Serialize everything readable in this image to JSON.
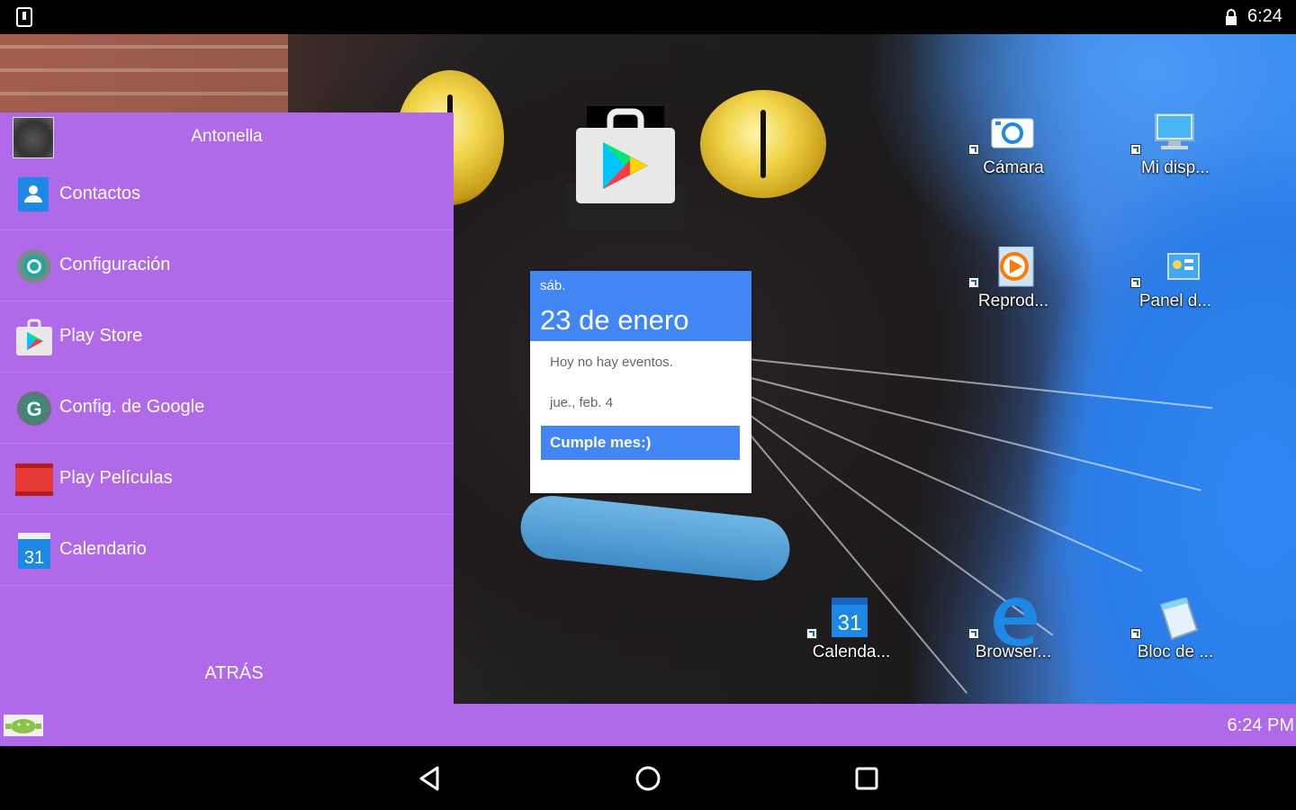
{
  "status_bar": {
    "time": "6:24",
    "notification_icon": "sdcard-icon",
    "lock_icon": "lock-icon"
  },
  "drawer": {
    "user_name": "Antonella",
    "items": [
      {
        "label": "Contactos",
        "icon": "contacts-icon"
      },
      {
        "label": "Configuración",
        "icon": "settings-icon"
      },
      {
        "label": "Play Store",
        "icon": "play-store-icon"
      },
      {
        "label": "Config. de Google",
        "icon": "google-settings-icon"
      },
      {
        "label": "Play Películas",
        "icon": "play-movies-icon"
      },
      {
        "label": "Calendario",
        "icon": "calendar-icon"
      }
    ],
    "back_label": "ATRÁS"
  },
  "widget": {
    "day": "sáb.",
    "date": "23 de enero",
    "no_events": "Hoy no hay eventos.",
    "next_date": "jue., feb. 4",
    "event_title": "Cumple mes:)"
  },
  "desktop": {
    "shortcuts": [
      {
        "label": "Cámara",
        "icon": "camera-icon"
      },
      {
        "label": "Mi disp...",
        "icon": "computer-icon"
      },
      {
        "label": "Reprod...",
        "icon": "media-player-icon"
      },
      {
        "label": "Panel d...",
        "icon": "control-panel-icon"
      },
      {
        "label": "Calenda...",
        "icon": "calendar-icon",
        "badge": "31"
      },
      {
        "label": "Browser...",
        "icon": "edge-browser-icon"
      },
      {
        "label": "Bloc de ...",
        "icon": "notepad-icon"
      }
    ]
  },
  "taskbar": {
    "time": "6:24 PM"
  },
  "navbar": {
    "back": "back-icon",
    "home": "home-icon",
    "recents": "recents-icon"
  },
  "colors": {
    "accent": "#b06ae9",
    "google_blue": "#4285f4"
  }
}
